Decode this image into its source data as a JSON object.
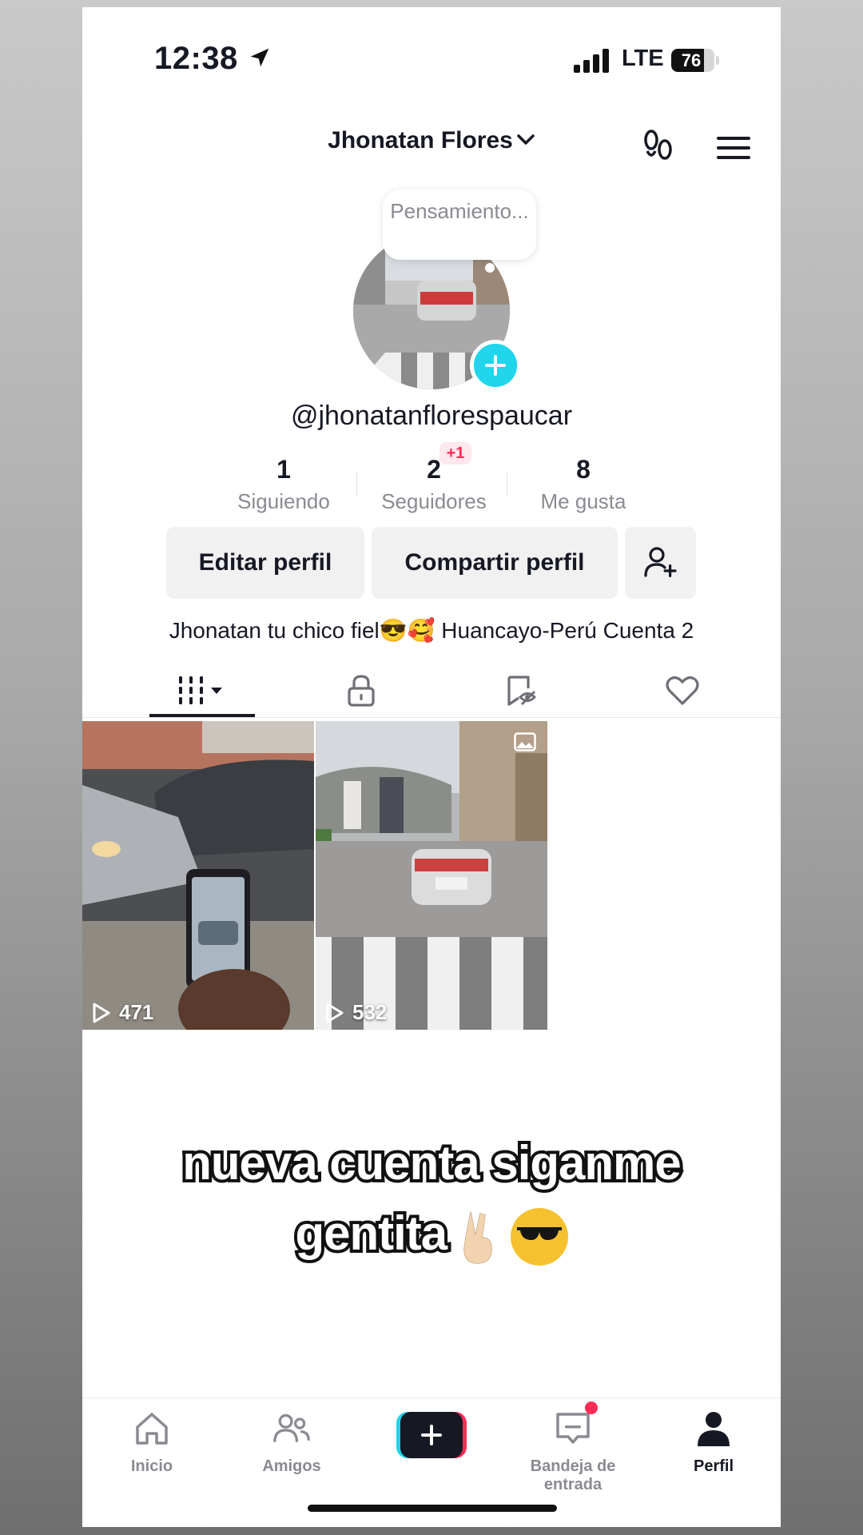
{
  "status_bar": {
    "time": "12:38",
    "network": "LTE",
    "battery": "76",
    "battery_level": 0.76
  },
  "header": {
    "name": "Jhonatan Flores",
    "icons": [
      "chevron-down-icon",
      "footprints-icon",
      "menu-icon"
    ]
  },
  "profile": {
    "thought_bubble": "Pensamiento...",
    "handle": "@jhonatanflorespaucar",
    "stats": [
      {
        "value": "1",
        "label": "Siguiendo"
      },
      {
        "value": "2",
        "label": "Seguidores",
        "badge": "+1"
      },
      {
        "value": "8",
        "label": "Me gusta"
      }
    ],
    "buttons": {
      "edit": "Editar perfil",
      "share": "Compartir perfil"
    },
    "bio": "Jhonatan tu chico fiel😎🥰 Huancayo-Perú  Cuenta 2"
  },
  "tabs": {
    "icons": [
      "grid-icon",
      "lock-icon",
      "reposts-icon",
      "heart-icon"
    ],
    "active": 0
  },
  "videos": [
    {
      "views": "471"
    },
    {
      "views": "532"
    }
  ],
  "caption": {
    "line1": "nueva cuenta siganme",
    "line2": "gentita"
  },
  "nav": {
    "items": [
      {
        "label": "Inicio",
        "icon": "home-icon"
      },
      {
        "label": "Amigos",
        "icon": "friends-icon"
      },
      {
        "label": "",
        "icon": "create-icon"
      },
      {
        "label": "Bandeja de entrada",
        "icon": "inbox-icon"
      },
      {
        "label": "Perfil",
        "icon": "profile-icon"
      }
    ],
    "active": 4,
    "colors": {
      "accent_red": "#fe2c55",
      "accent_cyan": "#20d5ec"
    }
  }
}
